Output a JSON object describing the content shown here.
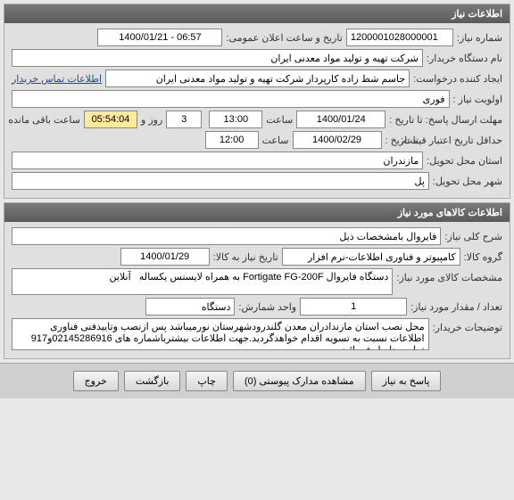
{
  "panel1": {
    "title": "اطلاعات نیاز",
    "labels": {
      "need_no": "شماره نیاز:",
      "announce": "تاریخ و ساعت اعلان عمومی:",
      "buyer": "نام دستگاه خریدار:",
      "creator": "ایجاد کننده درخواست:",
      "priority": "اولویت نیاز :",
      "contact_link": "اطلاعات تماس خریدار",
      "deadline": "مهلت ارسال پاسخ:  تا تاریخ :",
      "saat": "ساعت",
      "days": "روز و",
      "remain": "ساعت باقی مانده",
      "min_valid": "حداقل تاریخ اعتبار قیمت:",
      "until": "تا تاریخ :",
      "province": "استان محل تحویل:",
      "city": "شهر محل تحویل:"
    },
    "values": {
      "need_no": "1200001028000001",
      "announce": "1400/01/21 - 06:57",
      "buyer": "شرکت تهیه و تولید مواد معدنی ایران",
      "creator": "جاسم شط زاده کارپرداز شرکت تهیه و تولید مواد معدنی ایران",
      "priority": "فوری",
      "deadline_date": "1400/01/24",
      "deadline_time": "13:00",
      "days": "3",
      "remain_time": "05:54:04",
      "valid_date": "1400/02/29",
      "valid_time": "12:00",
      "province": "مازندران",
      "city": "پل"
    }
  },
  "panel2": {
    "title": "اطلاعات کالاهای مورد نیاز",
    "labels": {
      "desc": "شرح کلی نیاز:",
      "group": "گروه کالا:",
      "need_by": "تاریخ نیاز به کالا:",
      "spec": "مشخصات کالای مورد نیاز:",
      "qty": "تعداد / مقدار مورد نیاز:",
      "unit": "واحد شمارش:",
      "notes": "توضیحات خریدار:"
    },
    "values": {
      "desc": "فایروال بامشخصات ذیل",
      "group": "کامپیوتر و فناوری اطلاعات-نرم افزار",
      "need_by": "1400/01/29",
      "spec": "دستگاه فایروال Fortigate FG-200F به همراه لایسنس یکساله   آنلاین",
      "qty": "1",
      "unit": "دستگاه",
      "notes": "محل نصب استان مازندادران معدن گلندرودشهرستان نورمیباشد پس ازنصب وتاییدفنی فناوری اطلاعات نسبت به تسویه اقدام خواهدگردید.جهت اطلاعات بیشترباشماره های 02145286916و917 تماس حاصل فرمائید."
    }
  },
  "buttons": {
    "reply": "پاسخ به نیاز",
    "attach": "مشاهده مدارک پیوستی (0)",
    "print": "چاپ",
    "back": "بازگشت",
    "exit": "خروج"
  }
}
